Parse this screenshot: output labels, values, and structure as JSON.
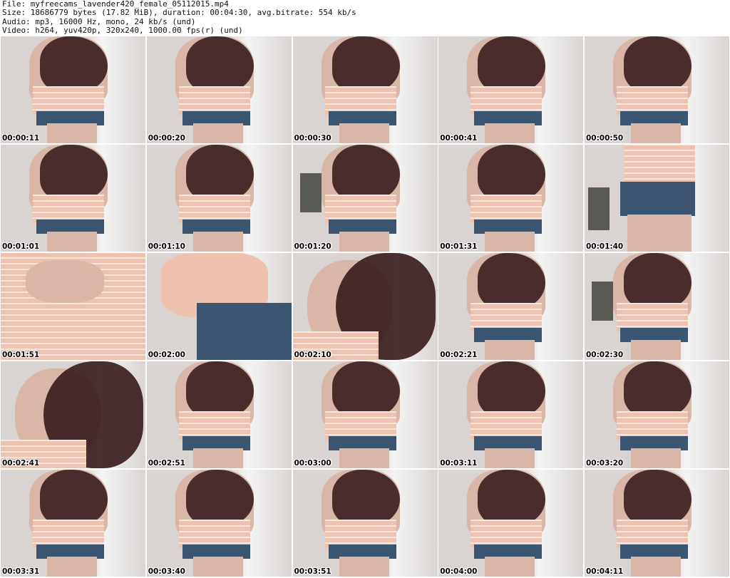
{
  "header": {
    "file_line": "File: myfreecams_lavender420_female_05112015.mp4",
    "size_line": "Size: 18686779 bytes (17.82 MiB), duration: 00:04:30, avg.bitrate: 554 kb/s",
    "audio_line": "Audio: mp3, 16000 Hz, mono, 24 kb/s (und)",
    "video_line": "Video: h264, yuv420p, 320x240, 1000.00 fps(r) (und)"
  },
  "thumbnails": [
    {
      "timestamp": "00:00:11",
      "scene": "lean"
    },
    {
      "timestamp": "00:00:20",
      "scene": "lean"
    },
    {
      "timestamp": "00:00:30",
      "scene": "lean"
    },
    {
      "timestamp": "00:00:41",
      "scene": "lean"
    },
    {
      "timestamp": "00:00:50",
      "scene": "lean"
    },
    {
      "timestamp": "00:01:01",
      "scene": "lean"
    },
    {
      "timestamp": "00:01:10",
      "scene": "lean"
    },
    {
      "timestamp": "00:01:20",
      "scene": "lean-poster"
    },
    {
      "timestamp": "00:01:31",
      "scene": "lean"
    },
    {
      "timestamp": "00:01:40",
      "scene": "standing-poster"
    },
    {
      "timestamp": "00:01:51",
      "scene": "closeup-top"
    },
    {
      "timestamp": "00:02:00",
      "scene": "closeup-skirt"
    },
    {
      "timestamp": "00:02:10",
      "scene": "closeup-face"
    },
    {
      "timestamp": "00:02:21",
      "scene": "lean"
    },
    {
      "timestamp": "00:02:30",
      "scene": "lean-poster"
    },
    {
      "timestamp": "00:02:41",
      "scene": "closeup-face"
    },
    {
      "timestamp": "00:02:51",
      "scene": "lean"
    },
    {
      "timestamp": "00:03:00",
      "scene": "lean"
    },
    {
      "timestamp": "00:03:11",
      "scene": "lean"
    },
    {
      "timestamp": "00:03:20",
      "scene": "lean"
    },
    {
      "timestamp": "00:03:31",
      "scene": "lean"
    },
    {
      "timestamp": "00:03:40",
      "scene": "lean"
    },
    {
      "timestamp": "00:03:51",
      "scene": "lean"
    },
    {
      "timestamp": "00:04:00",
      "scene": "lean"
    },
    {
      "timestamp": "00:04:11",
      "scene": "lean"
    }
  ],
  "colors": {
    "wall": "#d9d4d2",
    "window": "#f4f4f4",
    "skin": "#d8b6a8",
    "hair": "#3a1e1f",
    "top": "#efc2b0",
    "stripe": "#f7e6de",
    "denim": "#3b5470",
    "poster": "#5a5a55"
  }
}
